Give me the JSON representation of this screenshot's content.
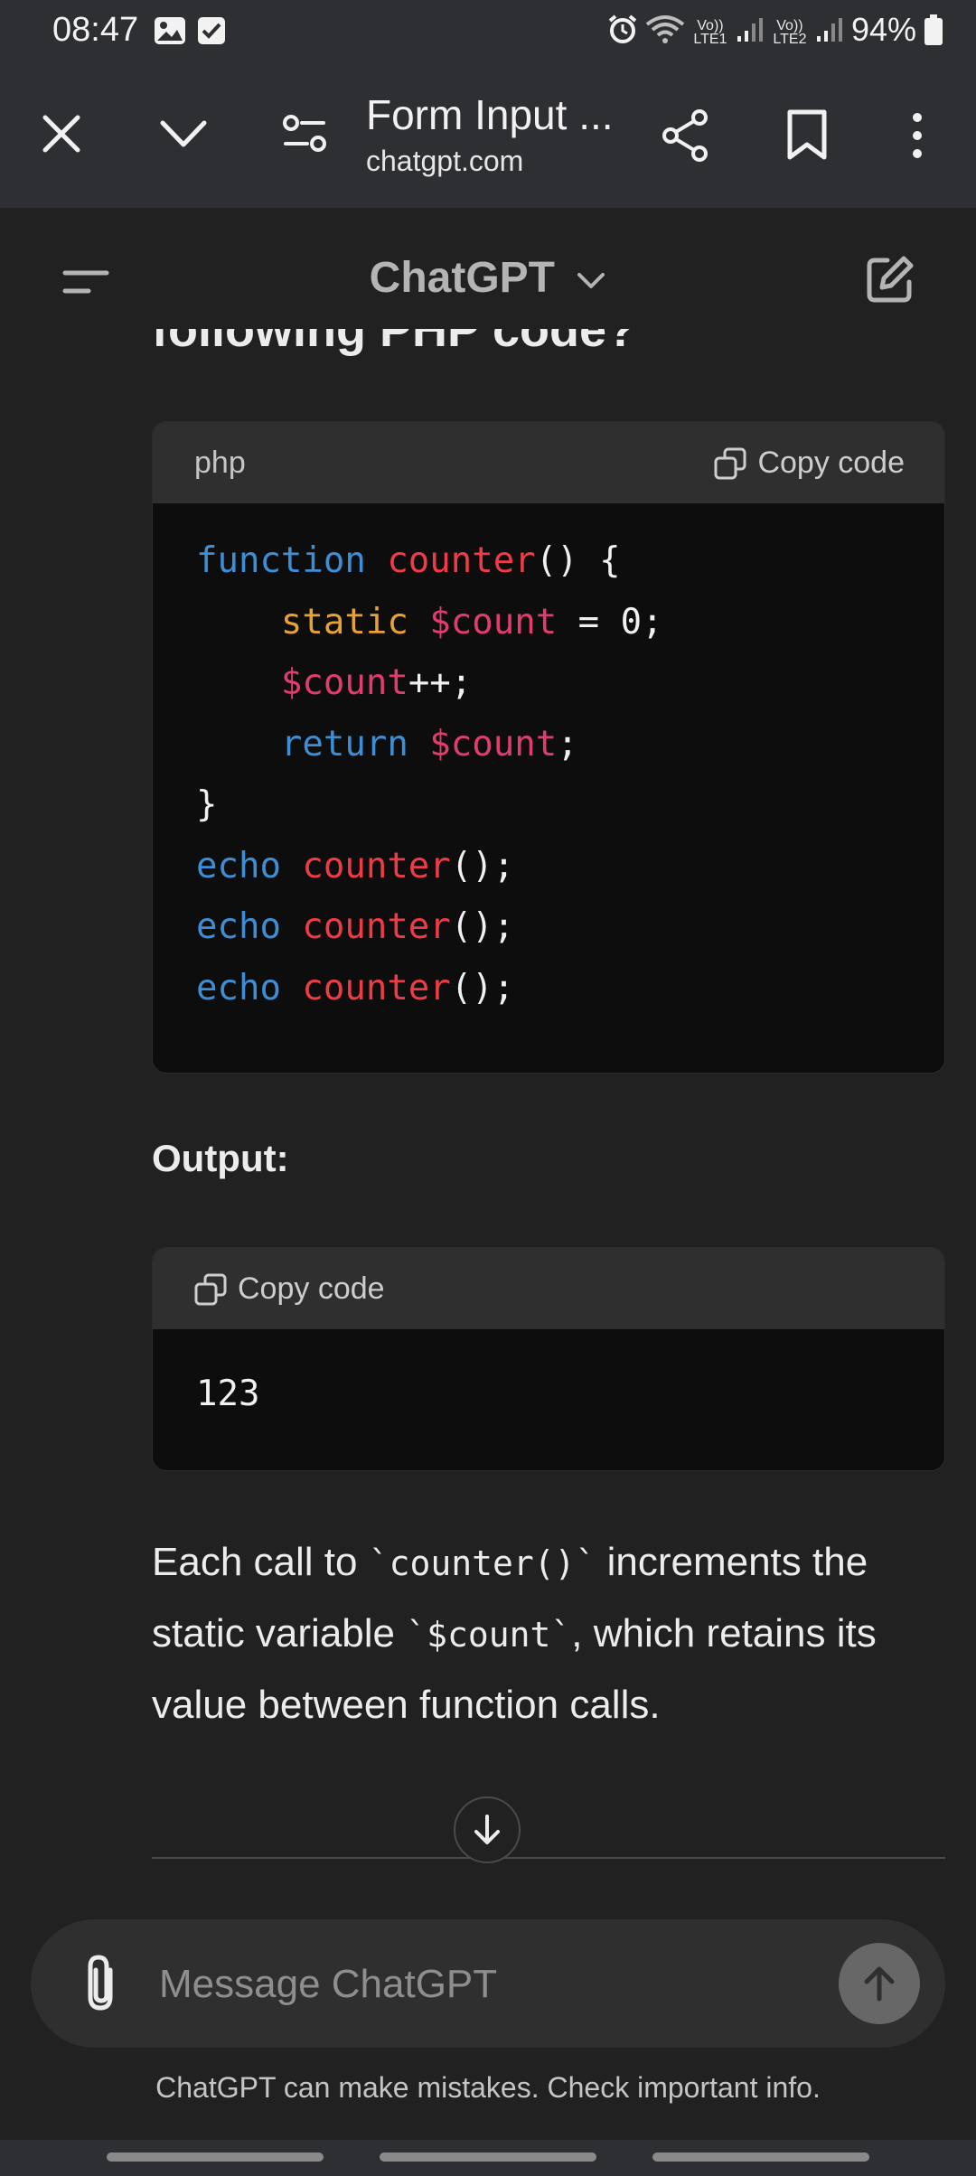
{
  "status_bar": {
    "time": "08:47",
    "battery": "94%",
    "sim1_label": "Vo)) LTE1",
    "sim2_label": "Vo)) LTE2",
    "icons": [
      "gallery-icon",
      "check-icon",
      "alarm-icon",
      "wifi-icon",
      "signal-icon",
      "battery-icon"
    ]
  },
  "browser": {
    "title": "Form Input ...",
    "domain": "chatgpt.com"
  },
  "chat": {
    "app_title": "ChatGPT",
    "partial_heading": "following PHP code?",
    "code_block_1": {
      "language": "php",
      "copy_label": "Copy code"
    },
    "output_label": "Output:",
    "code_block_2": {
      "copy_label": "Copy code",
      "output_value": "123"
    },
    "explanation": {
      "part1": "Each call to ",
      "code1": "`counter()`",
      "part2": " increments the static variable ",
      "code2": "`$count`",
      "part3": ", which retains its value between function calls."
    }
  },
  "composer": {
    "placeholder": "Message ChatGPT"
  },
  "disclaimer": "ChatGPT can make mistakes. Check important info.",
  "colors": {
    "background": "#212121",
    "code_bg": "#0d0d0d",
    "keyword_blue": "#3d8ed4",
    "function_red": "#ef3b46",
    "static_orange": "#e8a234",
    "variable_pink": "#e03c6c"
  }
}
